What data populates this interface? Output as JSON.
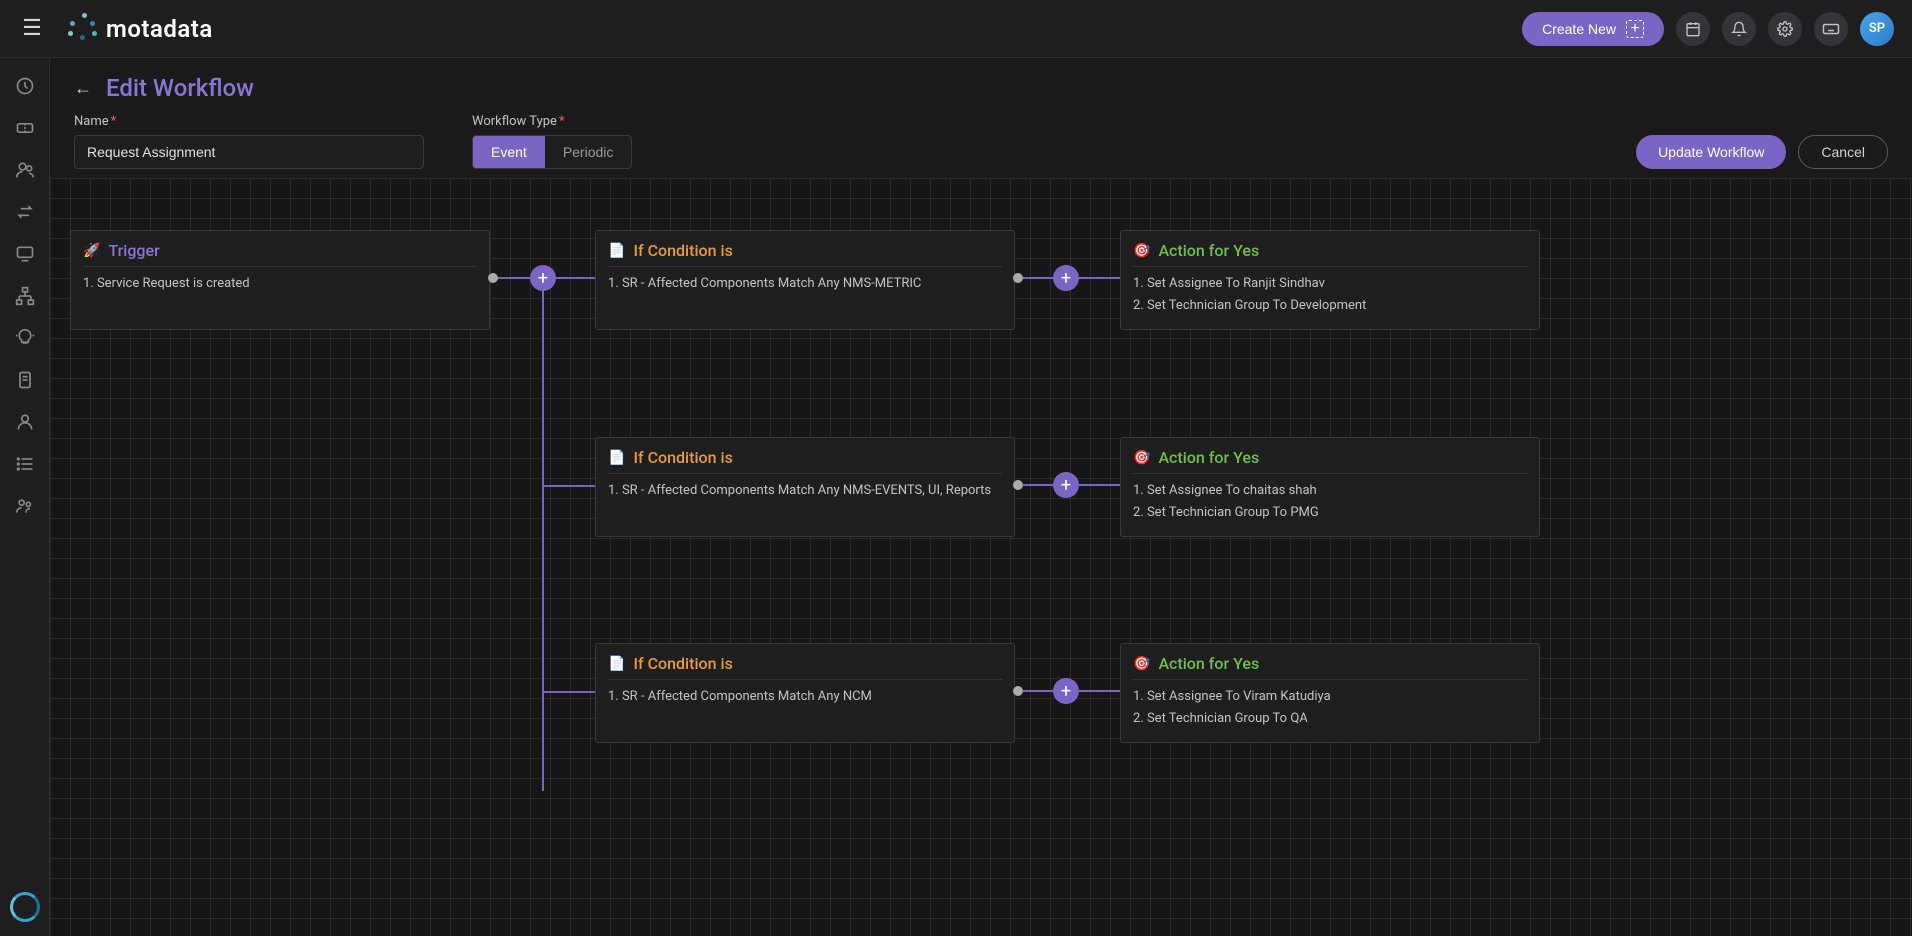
{
  "header": {
    "logo_text": "motadata",
    "create_new_label": "Create New",
    "avatar_initials": "SP"
  },
  "page": {
    "title": "Edit Workflow",
    "name_label": "Name",
    "name_value": "Request Assignment",
    "workflow_type_label": "Workflow Type",
    "type_event": "Event",
    "type_periodic": "Periodic",
    "update_btn": "Update Workflow",
    "cancel_btn": "Cancel"
  },
  "nodes": {
    "trigger": {
      "title": "Trigger",
      "line1": "1. Service Request is created"
    },
    "cond1": {
      "title": "If Condition is",
      "line1": "1. SR - Affected Components Match Any NMS-METRIC"
    },
    "cond2": {
      "title": "If Condition is",
      "line1": "1. SR - Affected Components Match Any NMS-EVENTS, UI, Reports"
    },
    "cond3": {
      "title": "If Condition is",
      "line1": "1. SR - Affected Components Match Any NCM"
    },
    "act1": {
      "title": "Action for Yes",
      "line1": "1. Set Assignee To Ranjit Sindhav",
      "line2": "2. Set Technician Group To Development"
    },
    "act2": {
      "title": "Action for Yes",
      "line1": "1. Set Assignee To chaitas shah",
      "line2": "2. Set Technician Group To PMG"
    },
    "act3": {
      "title": "Action for Yes",
      "line1": "1. Set Assignee To Viram Katudiya",
      "line2": "2. Set Technician Group To QA"
    }
  }
}
